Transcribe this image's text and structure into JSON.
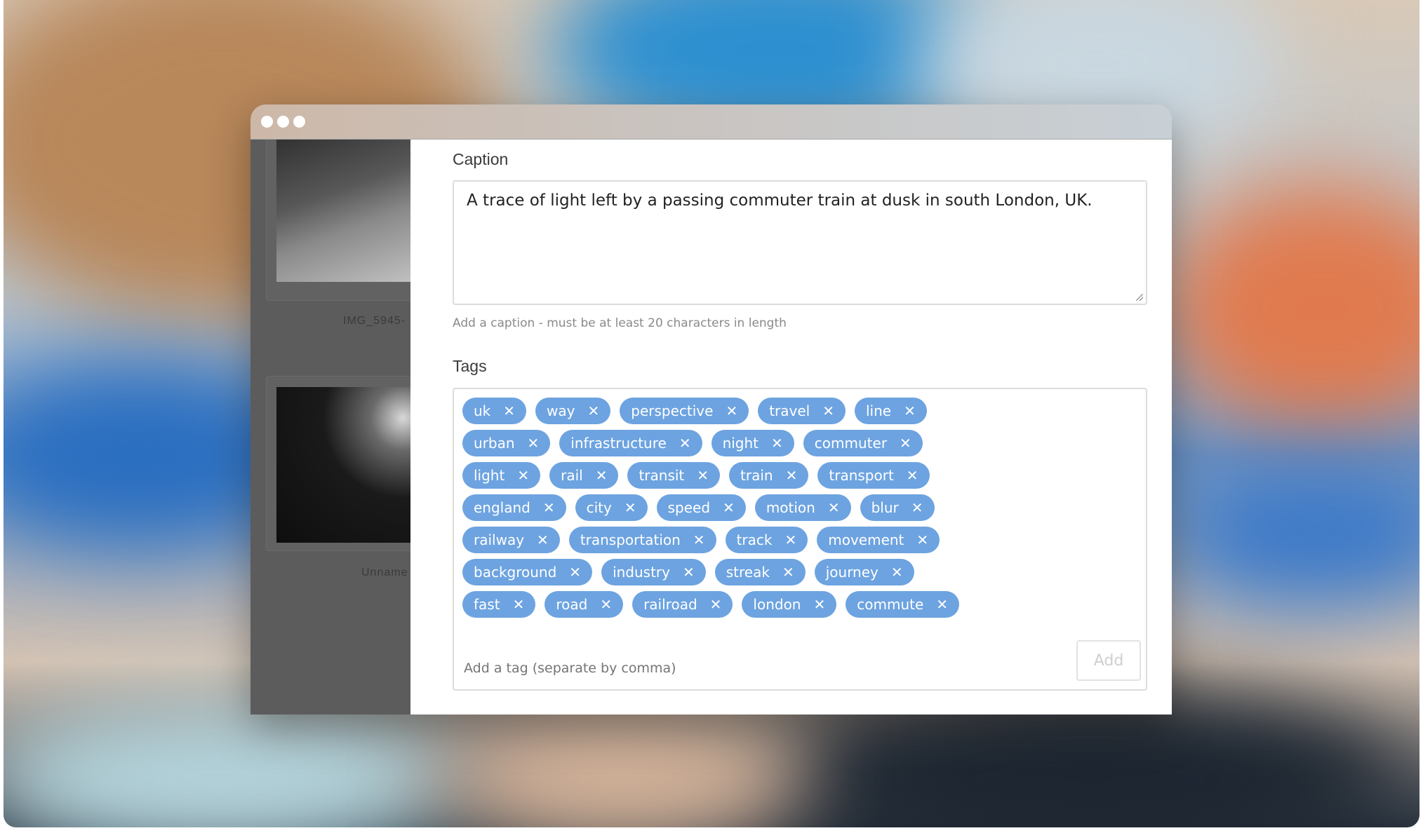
{
  "sidebar": {
    "items": [
      {
        "label": "IMG_5945-"
      },
      {
        "label": "Unname"
      }
    ]
  },
  "caption": {
    "label": "Caption",
    "value": "A trace of light left by a passing commuter train at dusk in south London, UK.",
    "hint": "Add a caption - must be at least 20 characters in length"
  },
  "tags": {
    "label": "Tags",
    "rows": [
      [
        "uk",
        "way",
        "perspective",
        "travel",
        "line"
      ],
      [
        "urban",
        "infrastructure",
        "night",
        "commuter"
      ],
      [
        "light",
        "rail",
        "transit",
        "train",
        "transport"
      ],
      [
        "england",
        "city",
        "speed",
        "motion",
        "blur"
      ],
      [
        "railway",
        "transportation",
        "track",
        "movement"
      ],
      [
        "background",
        "industry",
        "streak",
        "journey"
      ],
      [
        "fast",
        "road",
        "railroad",
        "london",
        "commute"
      ]
    ],
    "input_placeholder": "Add a tag (separate by comma)",
    "add_label": "Add",
    "remove_glyph": "✕"
  },
  "colors": {
    "tag_bg": "#6da3e0",
    "sidebar_bg": "#5c5c5c"
  }
}
